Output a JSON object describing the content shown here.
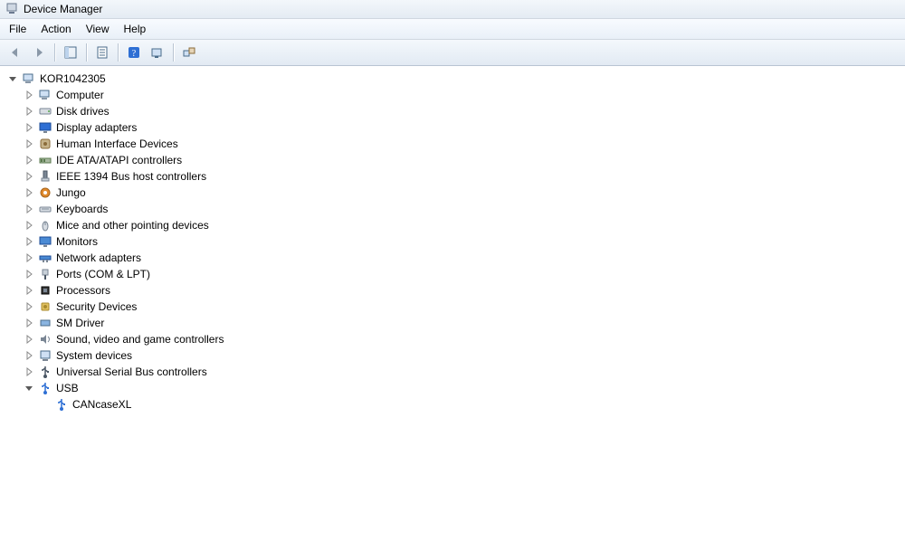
{
  "window": {
    "title": "Device Manager"
  },
  "menu": {
    "items": [
      "File",
      "Action",
      "View",
      "Help"
    ]
  },
  "tree": {
    "root": {
      "label": "KOR1042305",
      "icon": "computer-icon",
      "expanded": true
    },
    "categories": [
      {
        "label": "Computer",
        "icon": "computer-icon"
      },
      {
        "label": "Disk drives",
        "icon": "disk-icon"
      },
      {
        "label": "Display adapters",
        "icon": "display-icon"
      },
      {
        "label": "Human Interface Devices",
        "icon": "hid-icon"
      },
      {
        "label": "IDE ATA/ATAPI controllers",
        "icon": "ide-icon"
      },
      {
        "label": "IEEE 1394 Bus host controllers",
        "icon": "firewire-icon"
      },
      {
        "label": "Jungo",
        "icon": "jungo-icon"
      },
      {
        "label": "Keyboards",
        "icon": "keyboard-icon"
      },
      {
        "label": "Mice and other pointing devices",
        "icon": "mouse-icon"
      },
      {
        "label": "Monitors",
        "icon": "monitor-icon"
      },
      {
        "label": "Network adapters",
        "icon": "network-icon"
      },
      {
        "label": "Ports (COM & LPT)",
        "icon": "port-icon"
      },
      {
        "label": "Processors",
        "icon": "processor-icon"
      },
      {
        "label": "Security Devices",
        "icon": "security-icon"
      },
      {
        "label": "SM Driver",
        "icon": "sm-icon"
      },
      {
        "label": "Sound, video and game controllers",
        "icon": "sound-icon"
      },
      {
        "label": "System devices",
        "icon": "system-icon"
      },
      {
        "label": "Universal Serial Bus controllers",
        "icon": "usb-icon"
      },
      {
        "label": "USB",
        "icon": "usb-blue-icon",
        "expanded": true,
        "children": [
          {
            "label": "CANcaseXL",
            "icon": "usb-blue-icon"
          }
        ]
      }
    ]
  }
}
